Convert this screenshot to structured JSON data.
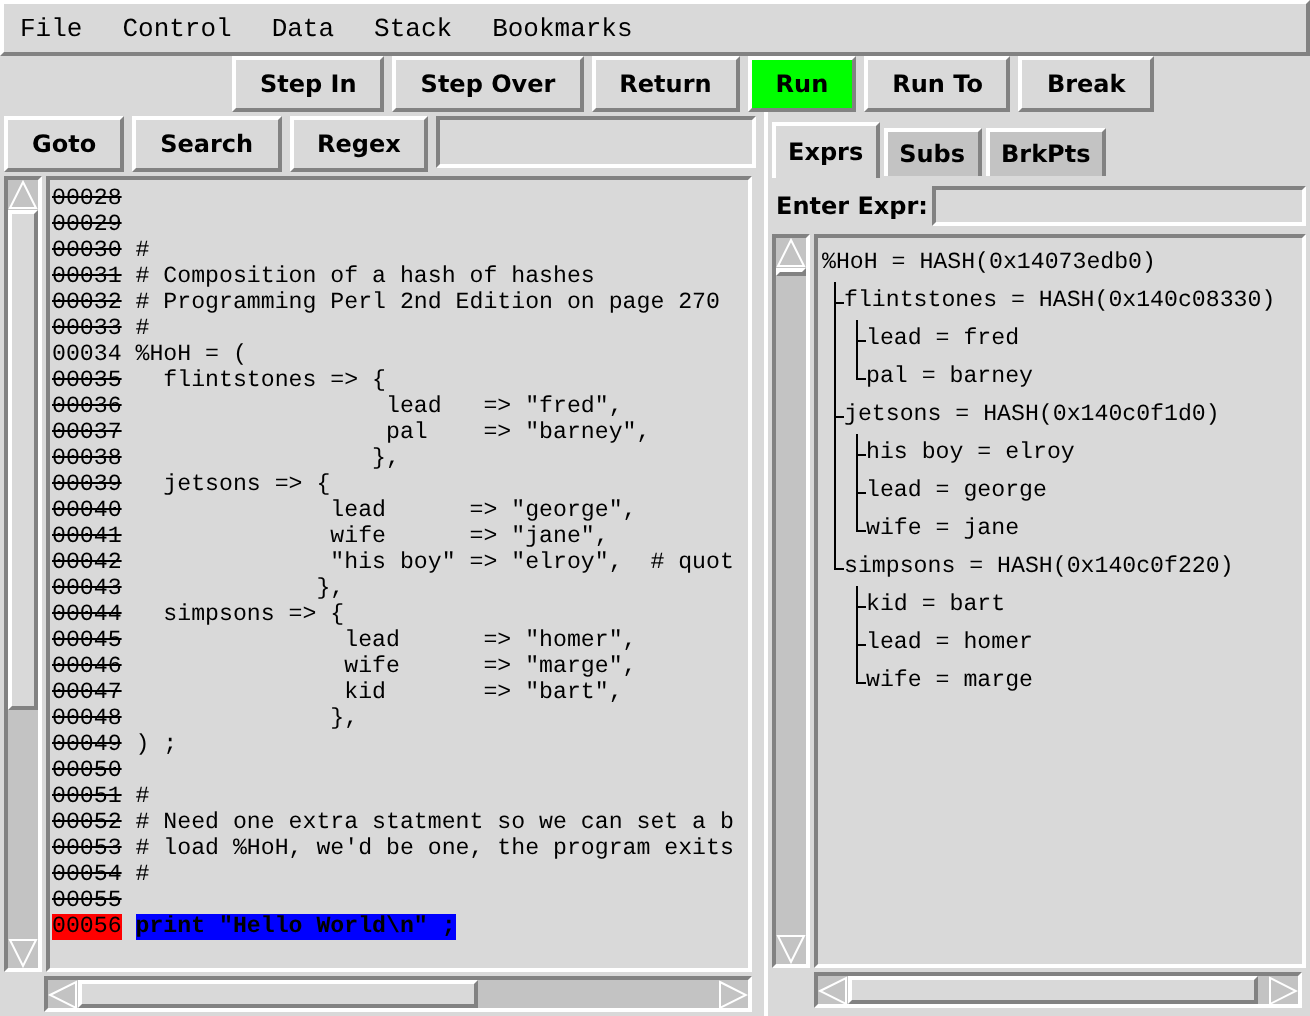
{
  "menu": [
    {
      "label": "File"
    },
    {
      "label": "Control"
    },
    {
      "label": "Data"
    },
    {
      "label": "Stack"
    },
    {
      "label": "Bookmarks"
    }
  ],
  "toolbar": [
    {
      "label": "Step In",
      "active": false
    },
    {
      "label": "Step Over",
      "active": false
    },
    {
      "label": "Return",
      "active": false
    },
    {
      "label": "Run",
      "active": true
    },
    {
      "label": "Run To",
      "active": false
    },
    {
      "label": "Break",
      "active": false
    }
  ],
  "search_bar": {
    "buttons": [
      "Goto",
      "Search",
      "Regex"
    ]
  },
  "source": [
    {
      "number": "00028",
      "breakable": false,
      "current": false
    },
    {
      "number": "00029",
      "breakable": false,
      "current": false
    },
    {
      "number": "00030",
      "code": "#",
      "breakable": false,
      "current": false
    },
    {
      "number": "00031",
      "code": "# Composition of a hash of hashes",
      "breakable": false,
      "current": false
    },
    {
      "number": "00032",
      "code": "# Programming Perl 2nd Edition on page 270",
      "breakable": false,
      "current": false
    },
    {
      "number": "00033",
      "code": "#",
      "breakable": false,
      "current": false
    },
    {
      "number": "00034",
      "code": "%HoH = (",
      "breakable": true,
      "current": false
    },
    {
      "number": "00035",
      "code": "  flintstones => {",
      "breakable": false,
      "current": false
    },
    {
      "number": "00036",
      "code": "                  lead   => \"fred\",",
      "breakable": false,
      "current": false
    },
    {
      "number": "00037",
      "code": "                  pal    => \"barney\",",
      "breakable": false,
      "current": false
    },
    {
      "number": "00038",
      "code": "                 },",
      "breakable": false,
      "current": false
    },
    {
      "number": "00039",
      "code": "  jetsons => {",
      "breakable": false,
      "current": false
    },
    {
      "number": "00040",
      "code": "              lead      => \"george\",",
      "breakable": false,
      "current": false
    },
    {
      "number": "00041",
      "code": "              wife      => \"jane\",",
      "breakable": false,
      "current": false
    },
    {
      "number": "00042",
      "code": "              \"his boy\" => \"elroy\",  # quot",
      "breakable": false,
      "current": false
    },
    {
      "number": "00043",
      "code": "             },",
      "breakable": false,
      "current": false
    },
    {
      "number": "00044",
      "code": "  simpsons => {",
      "breakable": false,
      "current": false
    },
    {
      "number": "00045",
      "code": "               lead      => \"homer\",",
      "breakable": false,
      "current": false
    },
    {
      "number": "00046",
      "code": "               wife      => \"marge\",",
      "breakable": false,
      "current": false
    },
    {
      "number": "00047",
      "code": "               kid       => \"bart\",",
      "breakable": false,
      "current": false
    },
    {
      "number": "00048",
      "code": "              },",
      "breakable": false,
      "current": false
    },
    {
      "number": "00049",
      "code": ") ;",
      "breakable": false,
      "current": false
    },
    {
      "number": "00050",
      "breakable": false,
      "current": false
    },
    {
      "number": "00051",
      "code": "#",
      "breakable": false,
      "current": false
    },
    {
      "number": "00052",
      "code": "# Need one extra statment so we can set a b",
      "breakable": false,
      "current": false
    },
    {
      "number": "00053",
      "code": "# load %HoH, we'd be one, the program exits",
      "breakable": false,
      "current": false
    },
    {
      "number": "00054",
      "code": "#",
      "breakable": false,
      "current": false
    },
    {
      "number": "00055",
      "breakable": false,
      "current": false
    },
    {
      "number": "00056",
      "code": "print \"Hello World\\n\" ;",
      "breakable": true,
      "current": true
    }
  ],
  "tabs": [
    {
      "label": "Exprs",
      "selected": true
    },
    {
      "label": "Subs",
      "selected": false
    },
    {
      "label": "BrkPts",
      "selected": false
    }
  ],
  "expr_entry": {
    "label": "Enter Expr:"
  },
  "tree": [
    {
      "label": "%HoH = HASH(0x14073edb0)",
      "children": [
        {
          "label": "flintstones = HASH(0x140c08330)",
          "children": [
            {
              "label": "lead = fred"
            },
            {
              "label": "pal = barney"
            }
          ]
        },
        {
          "label": "jetsons = HASH(0x140c0f1d0)",
          "children": [
            {
              "label": "his boy = elroy"
            },
            {
              "label": "lead = george"
            },
            {
              "label": "wife = jane"
            }
          ]
        },
        {
          "label": "simpsons = HASH(0x140c0f220)",
          "children": [
            {
              "label": "kid = bart"
            },
            {
              "label": "lead = homer"
            },
            {
              "label": "wife = marge"
            }
          ]
        }
      ]
    }
  ]
}
